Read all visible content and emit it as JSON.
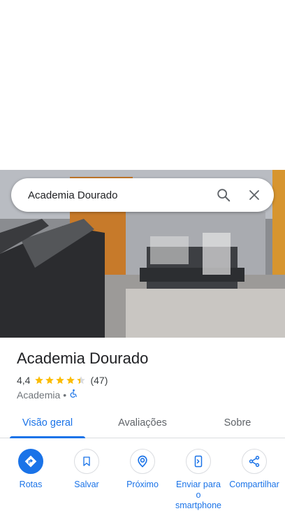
{
  "search": {
    "value": "Academia Dourado"
  },
  "place": {
    "name": "Academia Dourado",
    "rating": "4,4",
    "rating_value": 4.4,
    "review_count": "(47)",
    "category": "Academia",
    "separator": "•"
  },
  "tabs": [
    {
      "label": "Visão geral",
      "active": true
    },
    {
      "label": "Avaliações",
      "active": false
    },
    {
      "label": "Sobre",
      "active": false
    }
  ],
  "actions": [
    {
      "label": "Rotas",
      "icon": "directions-icon"
    },
    {
      "label": "Salvar",
      "icon": "bookmark-icon"
    },
    {
      "label": "Próximo",
      "icon": "nearby-icon"
    },
    {
      "label": "Enviar para o smartphone",
      "icon": "send-to-phone-icon"
    },
    {
      "label": "Compartilhar",
      "icon": "share-icon"
    }
  ],
  "colors": {
    "accent": "#1a73e8",
    "star": "#fbbc04",
    "text": "#202124",
    "secondary": "#70757a"
  }
}
